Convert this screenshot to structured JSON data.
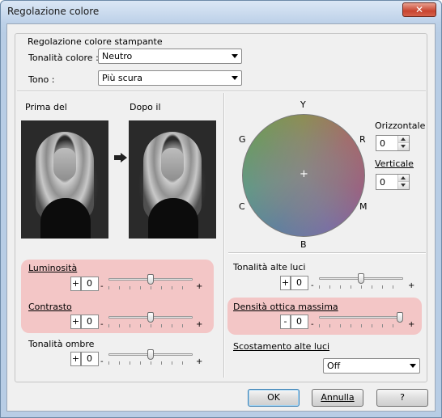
{
  "window": {
    "title": "Regolazione colore",
    "close_label": "✕"
  },
  "group": {
    "legend": "Regolazione colore stampante"
  },
  "tonalita": {
    "label": "Tonalità colore :",
    "value": "Neutro"
  },
  "tono": {
    "label": "Tono :",
    "value": "Più scura"
  },
  "preview": {
    "before": "Prima del",
    "after": "Dopo il"
  },
  "wheel": {
    "top": "Y",
    "right_top": "R",
    "right_bottom": "M",
    "bottom": "B",
    "left_bottom": "C",
    "left_top": "G",
    "center": "+"
  },
  "orizzontale": {
    "label": "Orizzontale",
    "value": "0"
  },
  "verticale": {
    "label": "Verticale",
    "value": "0"
  },
  "luminosita": {
    "label": "Luminosità",
    "sign": "+",
    "value": "0",
    "level": 0.5
  },
  "contrasto": {
    "label": "Contrasto",
    "sign": "+",
    "value": "0",
    "level": 0.5
  },
  "ombre": {
    "label": "Tonalità ombre",
    "sign": "+",
    "value": "0",
    "level": 0.5
  },
  "alte_luci": {
    "label": "Tonalità alte luci",
    "sign": "+",
    "value": "0",
    "level": 0.5
  },
  "densita": {
    "label": "Densità ottica massima",
    "sign": "-",
    "value": "0",
    "level": 1.0
  },
  "scostamento": {
    "label": "Scostamento alte luci",
    "value": "Off"
  },
  "slider_marks": {
    "minus": "-",
    "plus": "+"
  },
  "buttons": {
    "ok": "OK",
    "annulla": "Annulla",
    "help": "?"
  },
  "colors": {
    "highlight": "#f3c6c6",
    "default_border": "#3c7fb1"
  }
}
